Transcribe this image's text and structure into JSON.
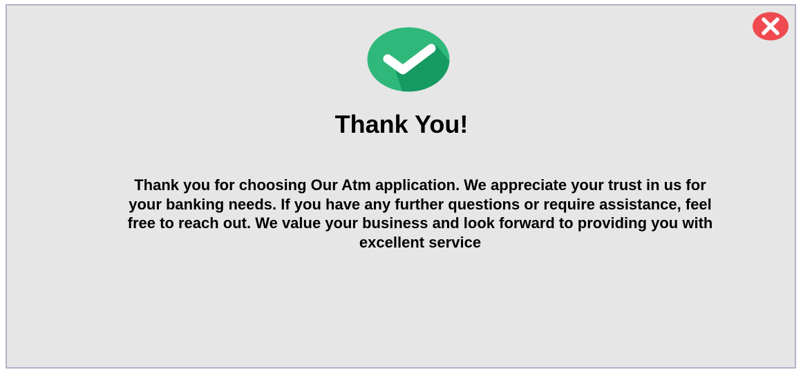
{
  "dialog": {
    "title": "Thank You!",
    "message": "Thank you for choosing Our Atm application. We appreciate your trust in us for your banking needs. If you have any further questions or require assistance, feel free to reach out. We value your business and look forward to providing you with excellent service",
    "success_icon": "check-circle-icon",
    "close_icon": "close-icon"
  },
  "colors": {
    "dialog_background": "#e6e6e6",
    "dialog_border": "#b4b1c8",
    "success_green": "#2fb87a",
    "success_green_shadow": "#159a62",
    "close_red": "#ef4a50"
  }
}
